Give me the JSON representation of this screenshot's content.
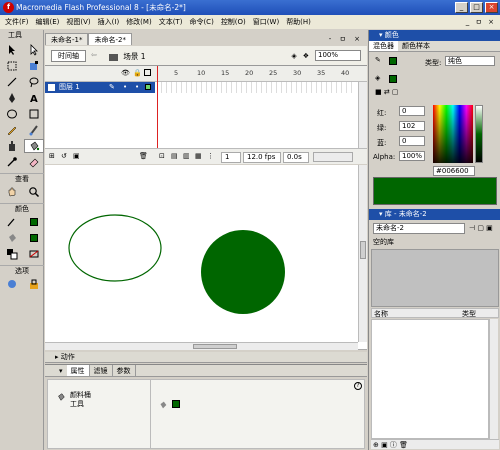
{
  "window": {
    "title": "Macromedia Flash Professional 8 - [未命名-2*]",
    "controls": [
      "_",
      "□",
      "×"
    ]
  },
  "menu": [
    "文件(F)",
    "编辑(E)",
    "视图(V)",
    "插入(I)",
    "修改(M)",
    "文本(T)",
    "命令(C)",
    "控制(O)",
    "窗口(W)",
    "帮助(H)"
  ],
  "menu_doc_controls": "_ ㅁ ×",
  "tools": {
    "title": "工具",
    "view_label": "查看",
    "colors_label": "颜色",
    "options_label": "选项"
  },
  "doc_tabs": {
    "tab1": "未命名-1*",
    "tab2": "未命名-2*",
    "controls": "- ㅁ ×"
  },
  "scene_bar": {
    "timeline_button": "时间轴",
    "scene_label": "场景 1",
    "zoom": "100%"
  },
  "timeline": {
    "ruler": [
      "5",
      "10",
      "15",
      "20",
      "25",
      "30",
      "35",
      "40"
    ],
    "layer_name": "图层 1",
    "current_frame": "1",
    "fps": "12.0 fps",
    "time": "0.0s"
  },
  "panels": {
    "actions": "动作",
    "props_tabs": [
      "属性",
      "滤镜",
      "参数"
    ],
    "tool_name_line1": "颜料桶",
    "tool_name_line2": "工具",
    "help_icon": "?"
  },
  "color_mixer": {
    "header": "颜色",
    "tabs": [
      "混色器",
      "颜色样本"
    ],
    "type_label": "类型:",
    "type_value": "纯色",
    "red_label": "红:",
    "red_value": "0",
    "green_label": "绿:",
    "green_value": "102",
    "blue_label": "蓝:",
    "blue_value": "0",
    "alpha_label": "Alpha:",
    "alpha_value": "100%",
    "hex_value": "#006600",
    "fill_color": "#006600"
  },
  "library": {
    "header": "库 - 未命名-2",
    "doc_select": "未命名-2",
    "empty_label": "空的库",
    "col_name": "名称",
    "col_type": "类型"
  },
  "stage_shapes": {
    "ellipse_stroke": "#006600",
    "circle_fill": "#006600"
  }
}
